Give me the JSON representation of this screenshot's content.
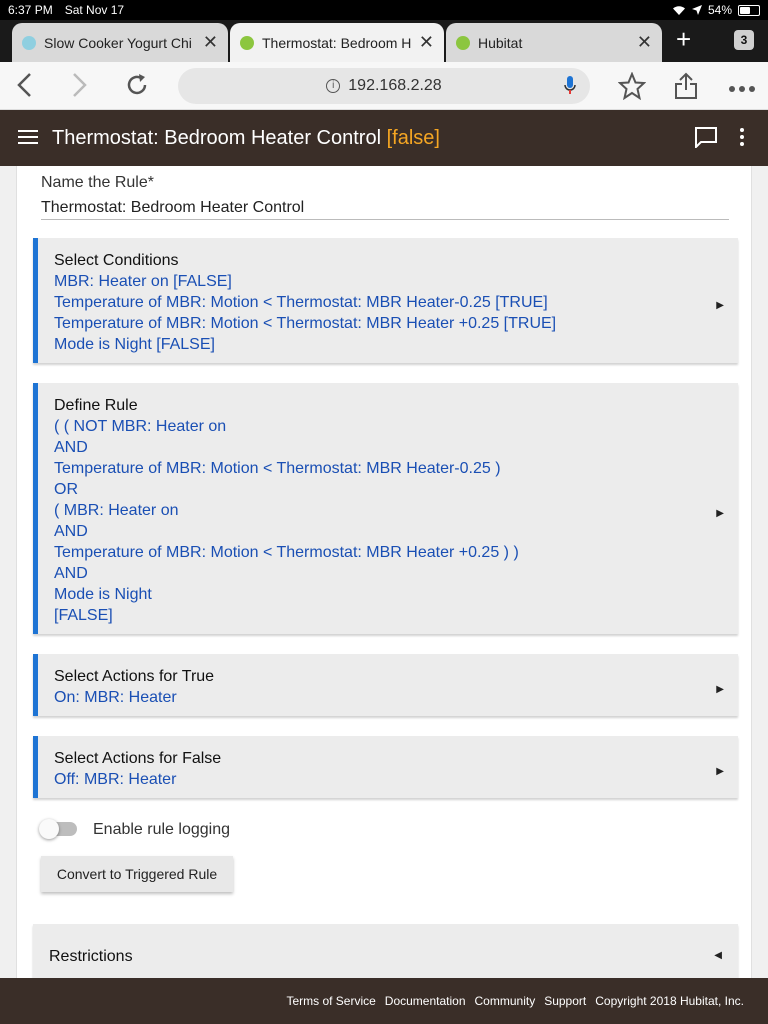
{
  "status_bar": {
    "time": "6:37 PM",
    "date": "Sat Nov 17",
    "battery": "54%",
    "battery_level": 0.54
  },
  "tabs": [
    {
      "title": "Slow Cooker Yogurt Chi",
      "active": false,
      "favicon_color": "#8fcfe0"
    },
    {
      "title": "Thermostat: Bedroom H",
      "active": true,
      "favicon_color": "#8cc63f"
    },
    {
      "title": "Hubitat",
      "active": false,
      "favicon_color": "#8cc63f"
    }
  ],
  "tab_count": "3",
  "url": "192.168.2.28",
  "app_header": {
    "title": "Thermostat: Bedroom Heater Control",
    "flag": "[false]"
  },
  "rule_name": {
    "label": "Name the Rule*",
    "value": "Thermostat: Bedroom Heater Control"
  },
  "sections": {
    "conditions": {
      "heading": "Select Conditions",
      "lines": [
        "MBR: Heater on [FALSE]",
        "Temperature of MBR: Motion  < Thermostat: MBR Heater-0.25 [TRUE]",
        "Temperature of MBR: Motion  < Thermostat: MBR Heater +0.25 [TRUE]",
        "Mode is Night [FALSE]"
      ]
    },
    "define_rule": {
      "heading": "Define Rule",
      "lines": [
        "( ( NOT MBR: Heater on",
        "AND",
        "Temperature of MBR: Motion  < Thermostat: MBR Heater-0.25 )",
        "OR",
        "( MBR: Heater on",
        "AND",
        "Temperature of MBR: Motion  < Thermostat: MBR Heater +0.25 ) )",
        "AND",
        "Mode is Night",
        "[FALSE]"
      ]
    },
    "actions_true": {
      "heading": "Select Actions for True",
      "lines": [
        "On: MBR: Heater"
      ]
    },
    "actions_false": {
      "heading": "Select Actions for False",
      "lines": [
        "Off: MBR: Heater"
      ]
    }
  },
  "logging_toggle": {
    "label": "Enable rule logging",
    "enabled": false
  },
  "convert_button": "Convert to Triggered Rule",
  "restrictions": "Restrictions",
  "footer": {
    "links": [
      "Terms of Service",
      "Documentation",
      "Community",
      "Support"
    ],
    "copyright": "Copyright 2018 Hubitat, Inc."
  },
  "colors": {
    "header_bg": "#3a2e28",
    "accent": "#1e74d4",
    "link_text": "#1a4fb4",
    "flag": "#f5a623"
  }
}
